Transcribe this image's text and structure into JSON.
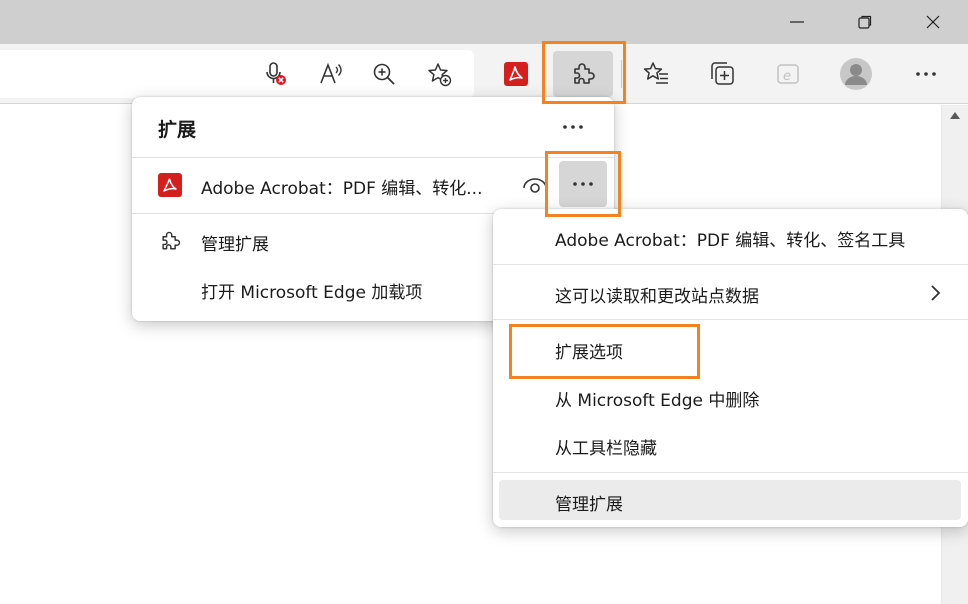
{
  "panel": {
    "title": "扩展",
    "extension_name": "Adobe Acrobat：PDF 编辑、转化...",
    "manage_label": "管理扩展",
    "open_addons_label": "打开 Microsoft Edge 加载项"
  },
  "context_menu": {
    "header": "Adobe Acrobat：PDF 编辑、转化、签名工具",
    "permissions": "这可以读取和更改站点数据",
    "options": "扩展选项",
    "remove": "从 Microsoft Edge 中删除",
    "hide": "从工具栏隐藏",
    "manage": "管理扩展"
  },
  "colors": {
    "highlight": "#f58220",
    "acrobat_red": "#d51f1f",
    "mic_blocked": "#e81123"
  },
  "icons": {
    "titlebar": [
      "minimize-icon",
      "restore-icon",
      "close-icon"
    ],
    "address_bar": [
      "mic-blocked-icon",
      "read-aloud-icon",
      "zoom-in-icon",
      "add-favorite-icon"
    ],
    "toolbar": [
      "acrobat-icon",
      "extensions-puzzle-icon",
      "favorites-icon",
      "collections-icon",
      "ie-mode-icon",
      "profile-icon",
      "more-icon"
    ]
  }
}
